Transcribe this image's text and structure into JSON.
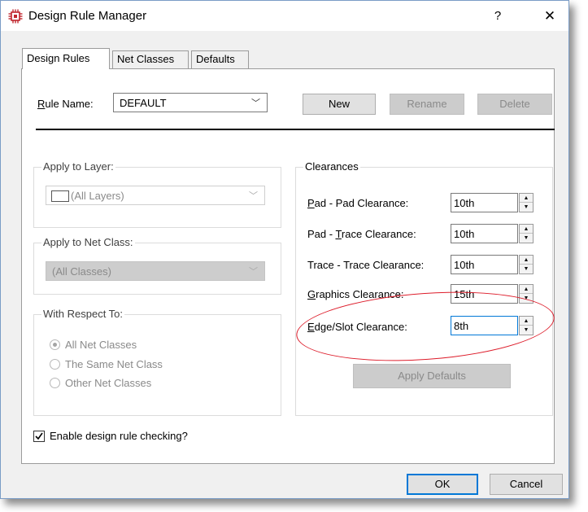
{
  "window": {
    "title": "Design Rule Manager",
    "help_glyph": "?",
    "close_glyph": "✕"
  },
  "tabs": [
    {
      "label": "Design Rules",
      "active": true
    },
    {
      "label": "Net Classes",
      "active": false
    },
    {
      "label": "Defaults",
      "active": false
    }
  ],
  "rule": {
    "name_label_u": "R",
    "name_label_rest": "ule Name:",
    "name_value": "DEFAULT"
  },
  "buttons": {
    "new": "New",
    "rename": "Rename",
    "delete": "Delete",
    "apply_defaults": "Apply Defaults",
    "ok": "OK",
    "cancel": "Cancel"
  },
  "apply_to_layer": {
    "title": "Apply to Layer:",
    "value": "(All Layers)"
  },
  "apply_to_net_class": {
    "title": "Apply to Net Class:",
    "value": "(All Classes)"
  },
  "with_respect_to": {
    "title": "With Respect To:",
    "options": [
      "All Net Classes",
      "The Same Net Class",
      "Other Net Classes"
    ],
    "selected": "All Net Classes"
  },
  "clearances": {
    "title": "Clearances",
    "rows": [
      {
        "label_u": "P",
        "label_pre": "",
        "label_rest": "ad - Pad Clearance:",
        "value": "10th"
      },
      {
        "label_u": "T",
        "label_pre": "Pad - ",
        "label_rest": "race Clearance:",
        "value": "10th"
      },
      {
        "label_u": "",
        "label_pre": "Trace - Trace Clearance:",
        "label_rest": "",
        "value": "10th"
      },
      {
        "label_u": "G",
        "label_pre": "",
        "label_rest": "raphics Clearance:",
        "value": "15th"
      },
      {
        "label_u": "E",
        "label_pre": "",
        "label_rest": "dge/Slot Clearance:",
        "value": "8th"
      }
    ]
  },
  "enable_drc": {
    "label": "Enable design rule checking?",
    "checked": true
  },
  "colors": {
    "highlight_ellipse": "#dd1c2a",
    "focus_border": "#0078d7"
  },
  "icons": {
    "app": "chip-icon",
    "combo_arrow": "chevron-down-icon",
    "spin": "spin-updown-icon"
  }
}
